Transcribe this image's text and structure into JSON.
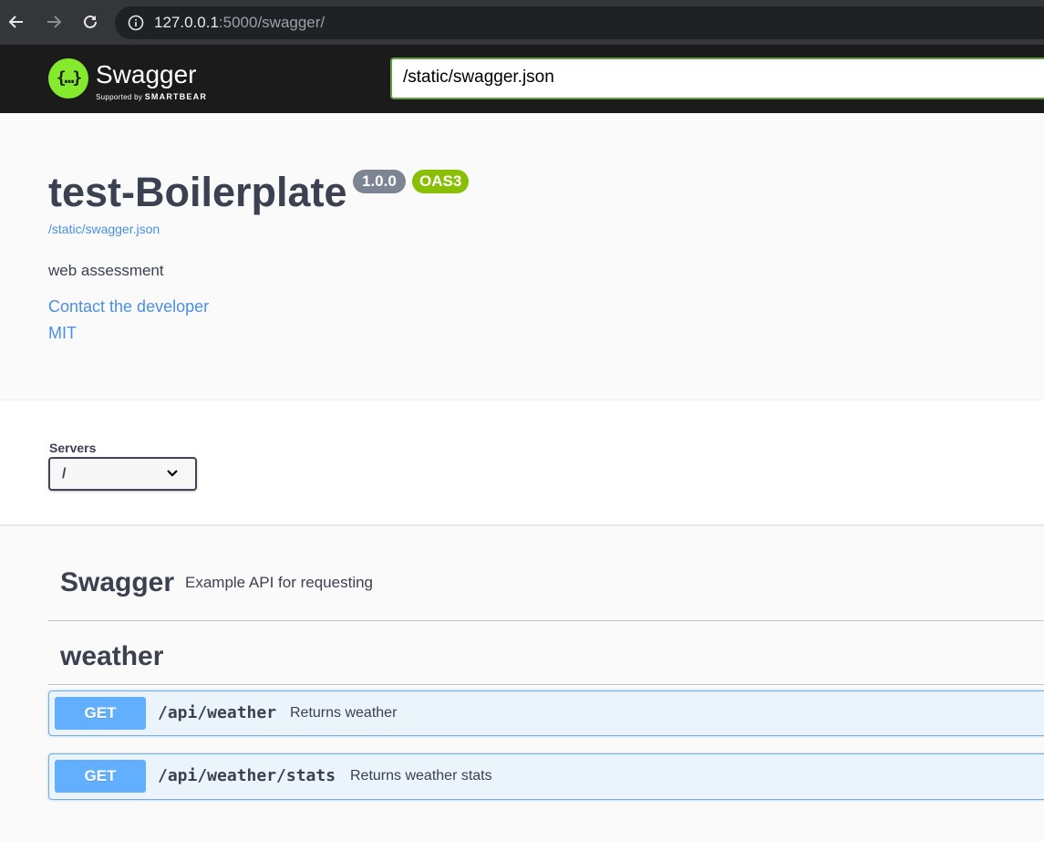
{
  "browser": {
    "url_host": "127.0.0.1",
    "url_rest": ":5000/swagger/"
  },
  "topbar": {
    "logo_text": "Swagger",
    "logo_sub_prefix": "Supported by",
    "logo_sub_brand": "SMARTBEAR",
    "spec_url_value": "/static/swagger.json"
  },
  "info": {
    "title": "test-Boilerplate",
    "version": "1.0.0",
    "oas_badge": "OAS3",
    "spec_link": "/static/swagger.json",
    "description": "web assessment",
    "contact_link": "Contact the developer",
    "license_link": "MIT"
  },
  "servers": {
    "label": "Servers",
    "selected": "/"
  },
  "tags": [
    {
      "name": "Swagger",
      "description": "Example API for requesting"
    },
    {
      "name": "weather"
    }
  ],
  "operations": [
    {
      "method": "GET",
      "path": "/api/weather",
      "summary": "Returns weather"
    },
    {
      "method": "GET",
      "path": "/api/weather/stats",
      "summary": "Returns weather stats"
    }
  ],
  "colors": {
    "get_accent": "#61affe",
    "oas_badge": "#89bf04",
    "version_badge": "#7d8492",
    "link": "#4990e2",
    "logo_green": "#85ea2d"
  }
}
